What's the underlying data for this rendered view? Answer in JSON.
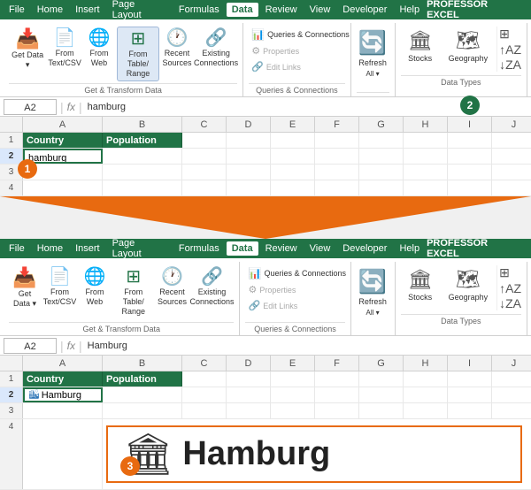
{
  "top_section": {
    "menu": {
      "items": [
        "File",
        "Home",
        "Insert",
        "Page Layout",
        "Formulas",
        "Data",
        "Review",
        "View",
        "Developer",
        "Help"
      ],
      "active": "Data",
      "brand": "PROFESSOR EXCEL"
    },
    "ribbon": {
      "groups": [
        {
          "name": "get_data",
          "label": "Get & Transform Data",
          "buttons": [
            {
              "id": "get_data",
              "icon": "📥",
              "label": "Get\nData ▾"
            },
            {
              "id": "from_text",
              "icon": "📄",
              "label": "From\nText/CSV"
            },
            {
              "id": "from_web",
              "icon": "🌐",
              "label": "From\nWeb"
            },
            {
              "id": "from_table",
              "icon": "⊞",
              "label": "From Table/\nRange",
              "highlighted": true
            },
            {
              "id": "recent_sources",
              "icon": "🕐",
              "label": "Recent\nSources"
            },
            {
              "id": "existing_conn",
              "icon": "🔗",
              "label": "Existing\nConnections"
            }
          ]
        },
        {
          "name": "queries_connections",
          "label": "Queries & Connections",
          "items": [
            "Queries & Connections",
            "Properties",
            "Edit Links"
          ]
        },
        {
          "name": "refresh",
          "label": "",
          "button": {
            "icon": "🔄",
            "label": "Refresh\nAll ▾"
          }
        },
        {
          "name": "data_types",
          "label": "Data Types",
          "buttons": [
            {
              "id": "stocks",
              "icon": "🏛",
              "label": "Stocks"
            },
            {
              "id": "geography",
              "icon": "🗺",
              "label": "Geography"
            }
          ]
        }
      ]
    },
    "formula_bar": {
      "name_box": "A2",
      "formula": "hamburg"
    },
    "spreadsheet": {
      "columns": [
        "A",
        "B",
        "C",
        "D",
        "E",
        "F",
        "G",
        "H",
        "I",
        "J"
      ],
      "rows": [
        {
          "num": "1",
          "cells": [
            "Country",
            "Population",
            "",
            "",
            "",
            "",
            "",
            "",
            "",
            ""
          ]
        },
        {
          "num": "2",
          "cells": [
            "hamburg",
            "",
            "",
            "",
            "",
            "",
            "",
            "",
            "",
            ""
          ]
        },
        {
          "num": "3",
          "cells": [
            "",
            "",
            "",
            "",
            "",
            "",
            "",
            "",
            "",
            ""
          ]
        },
        {
          "num": "4",
          "cells": [
            "",
            "",
            "",
            "",
            "",
            "",
            "",
            "",
            "",
            ""
          ]
        }
      ]
    }
  },
  "bottom_section": {
    "menu": {
      "items": [
        "File",
        "Home",
        "Insert",
        "Page Layout",
        "Formulas",
        "Data",
        "Review",
        "View",
        "Developer",
        "Help"
      ],
      "active": "Data",
      "brand": "PROFESSOR EXCEL"
    },
    "formula_bar": {
      "name_box": "A2",
      "formula": "Hamburg"
    },
    "spreadsheet": {
      "rows": [
        {
          "num": "1",
          "cells": [
            "Country",
            "Population",
            "",
            "",
            "",
            "",
            "",
            "",
            "",
            ""
          ]
        },
        {
          "num": "2",
          "cells": [
            "Hamburg",
            "",
            "",
            "",
            "",
            "",
            "",
            "",
            "",
            ""
          ]
        },
        {
          "num": "3",
          "cells": [
            "",
            "",
            "",
            "",
            "",
            "",
            "",
            "",
            "",
            ""
          ]
        },
        {
          "num": "4",
          "cells": [
            "",
            "",
            "",
            "",
            "",
            "",
            "",
            "",
            "",
            ""
          ]
        }
      ]
    },
    "hamburg_display": {
      "icon": "🏙",
      "text": "Hamburg"
    }
  },
  "annotations": {
    "one": "1",
    "two": "2",
    "three": "3"
  },
  "labels": {
    "get_data": "Get & Transform Data",
    "queries": "Queries & Connections",
    "data_types": "Data Types",
    "refresh_all": "Refresh\nAll ▾",
    "refresh": "Refresh",
    "stocks": "Stocks",
    "geography": "Geography",
    "country": "Country",
    "population": "Population",
    "hamburg_lower": "hamburg",
    "hamburg_cap": "Hamburg",
    "queries_connections": "Queries & Connections",
    "properties": "Properties",
    "edit_links": "Edit Links",
    "get_data_btn": "Get\nData ▾",
    "from_text_csv": "From\nText/CSV",
    "from_web": "From\nWeb",
    "from_table_range": "From Table/\nRange",
    "recent_sources": "Recent\nSources",
    "existing_connections": "Existing\nConnections",
    "sort_asc": "↑",
    "sort_desc": "↓"
  }
}
